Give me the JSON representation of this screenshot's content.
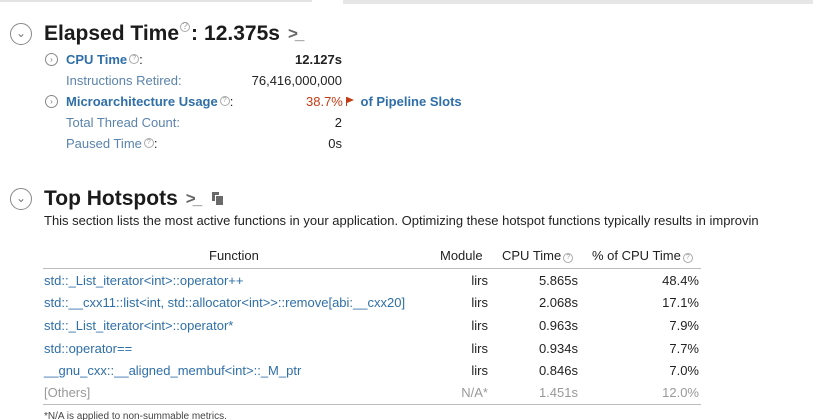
{
  "elapsed": {
    "title": "Elapsed Time",
    "colon": ":",
    "value": "12.375s",
    "metrics": {
      "cpu_time_label": "CPU Time",
      "cpu_time_colon": ":",
      "cpu_time_value": "12.127s",
      "instructions_label": "Instructions Retired:",
      "instructions_value": "76,416,000,000",
      "micro_label": "Microarchitecture Usage",
      "micro_colon": ":",
      "micro_value": "38.7%",
      "micro_suffix": "of Pipeline Slots",
      "thread_label": "Total Thread Count:",
      "thread_value": "2",
      "paused_label": "Paused Time",
      "paused_colon": ":",
      "paused_value": "0s"
    }
  },
  "hotspots": {
    "title": "Top Hotspots",
    "description": "This section lists the most active functions in your application. Optimizing these hotspot functions typically results in improvin",
    "columns": {
      "function": "Function",
      "module": "Module",
      "cpu_time": "CPU Time",
      "pct_cpu": "% of CPU Time"
    },
    "rows": [
      {
        "function": "std::_List_iterator<int>::operator++",
        "module": "lirs",
        "cpu": "5.865s",
        "pct": "48.4%"
      },
      {
        "function": "std::__cxx11::list<int, std::allocator<int>>::remove[abi:__cxx20]",
        "module": "lirs",
        "cpu": "2.068s",
        "pct": "17.1%"
      },
      {
        "function": "std::_List_iterator<int>::operator*",
        "module": "lirs",
        "cpu": "0.963s",
        "pct": "7.9%"
      },
      {
        "function": "std::operator==",
        "module": "lirs",
        "cpu": "0.934s",
        "pct": "7.7%"
      },
      {
        "function": "__gnu_cxx::__aligned_membuf<int>::_M_ptr",
        "module": "lirs",
        "cpu": "0.846s",
        "pct": "7.0%"
      },
      {
        "function": "[Others]",
        "module": "N/A*",
        "cpu": "1.451s",
        "pct": "12.0%"
      }
    ],
    "footnote": "*N/A is applied to non-summable metrics."
  },
  "colors": {
    "link": "#2f6fa8",
    "warning": "#c33b14"
  },
  "icons": [
    "collapse-icon",
    "help-icon",
    "terminal-icon",
    "flag-icon",
    "copy-icon",
    "expand-icon"
  ]
}
